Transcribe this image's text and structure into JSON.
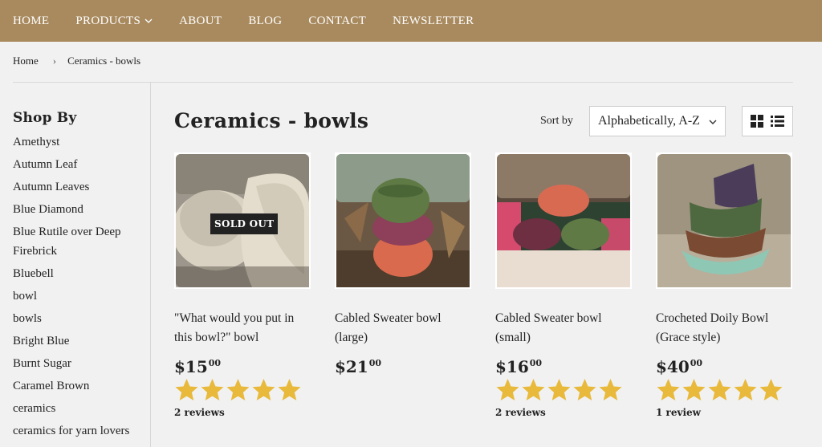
{
  "nav": {
    "items": [
      "HOME",
      "PRODUCTS",
      "ABOUT",
      "BLOG",
      "CONTACT",
      "NEWSLETTER"
    ]
  },
  "breadcrumb": {
    "home": "Home",
    "separator": "›",
    "current": "Ceramics - bowls"
  },
  "sidebar": {
    "heading": "Shop By",
    "items": [
      "Amethyst",
      "Autumn Leaf",
      "Autumn Leaves",
      "Blue Diamond",
      "Blue Rutile over Deep Firebrick",
      "Bluebell",
      "bowl",
      "bowls",
      "Bright Blue",
      "Burnt Sugar",
      "Caramel Brown",
      "ceramics",
      "ceramics for yarn lovers"
    ]
  },
  "main": {
    "title": "Ceramics - bowls",
    "sort_label": "Sort by",
    "sort_value": "Alphabetically, A-Z"
  },
  "products": [
    {
      "title": "\"What would you put in this bowl?\" bowl",
      "price_major": "$15",
      "price_minor": "00",
      "badge": "SOLD OUT",
      "rating": 5,
      "reviews": "2 reviews"
    },
    {
      "title": "Cabled Sweater bowl (large)",
      "price_major": "$21",
      "price_minor": "00",
      "badge": "",
      "rating": 0,
      "reviews": ""
    },
    {
      "title": "Cabled Sweater bowl (small)",
      "price_major": "$16",
      "price_minor": "00",
      "badge": "",
      "rating": 5,
      "reviews": "2 reviews"
    },
    {
      "title": "Crocheted Doily Bowl (Grace style)",
      "price_major": "$40",
      "price_minor": "00",
      "badge": "",
      "rating": 5,
      "reviews": "1 review"
    }
  ],
  "colors": {
    "nav_bg": "#a88a5e",
    "star": "#e8b93a",
    "badge_bg": "#222222"
  }
}
